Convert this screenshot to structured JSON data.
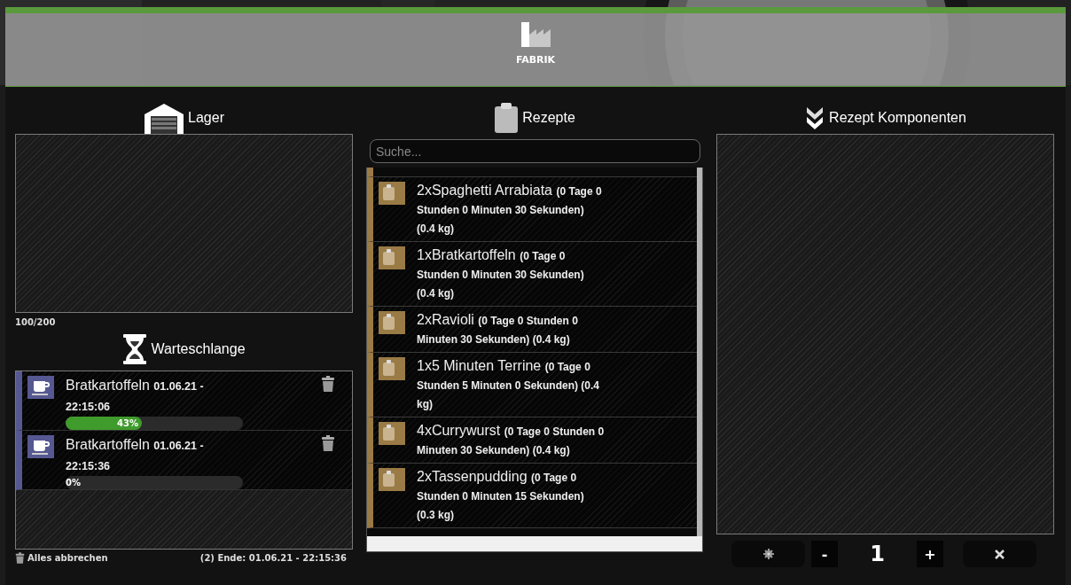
{
  "header": {
    "title": "FABRIK"
  },
  "storage": {
    "title": "Lager",
    "capacity": "100/200"
  },
  "queue": {
    "title": "Warteschlange",
    "items": [
      {
        "name": "Bratkartoffeln",
        "time": "01.06.21 - 22:15:06",
        "level": 0.43,
        "percent": "43%"
      },
      {
        "name": "Bratkartoffeln",
        "time": "01.06.21 - 22:15:36",
        "level": 0,
        "percent": "0%"
      }
    ],
    "cancel_all": "Alles abbrechen",
    "summary": "(2) Ende: 01.06.21 - 22:15:36"
  },
  "recipes": {
    "title": "Rezepte",
    "search": {
      "placeholder": "Suche..."
    },
    "items": [
      {
        "name": "2xSpaghetti Arrabiata",
        "details": "(0 Tage 0 Stunden 0 Minuten 30 Sekunden) (0.4 kg)"
      },
      {
        "name": "1xBratkartoffeln",
        "details": "(0 Tage 0 Stunden 0 Minuten 30 Sekunden) (0.4 kg)"
      },
      {
        "name": "2xRavioli",
        "details": "(0 Tage 0 Stunden 0 Minuten 30 Sekunden) (0.4 kg)"
      },
      {
        "name": "1x5 Minuten Terrine",
        "details": "(0 Tage 0 Stunden 5 Minuten 0 Sekunden) (0.4 kg)"
      },
      {
        "name": "4xCurrywurst",
        "details": "(0 Tage 0 Stunden 0 Minuten 30 Sekunden) (0.4 kg)"
      },
      {
        "name": "2xTassenpudding",
        "details": "(0 Tage 0 Stunden 0 Minuten 15 Sekunden) (0.3 kg)"
      }
    ]
  },
  "components": {
    "title": "Rezept Komponenten",
    "controls": [
      {
        "kind": "settings"
      },
      {
        "kind": "decrease",
        "label": "-"
      },
      {
        "kind": "amount",
        "label": "1"
      },
      {
        "kind": "increase",
        "label": "+"
      },
      {
        "kind": "clear"
      }
    ]
  }
}
